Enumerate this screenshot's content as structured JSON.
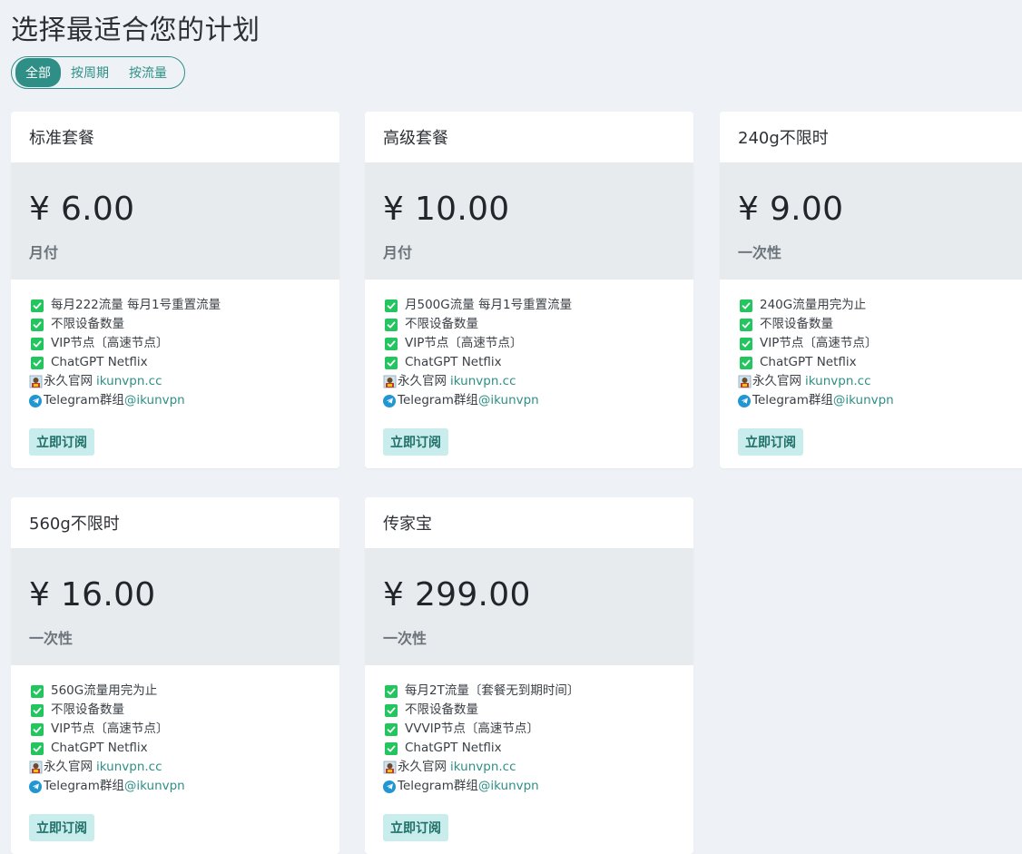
{
  "page": {
    "title": "选择最适合您的计划"
  },
  "filters": [
    {
      "label": "全部",
      "active": true
    },
    {
      "label": "按周期",
      "active": false
    },
    {
      "label": "按流量",
      "active": false
    }
  ],
  "plans": [
    {
      "name": "标准套餐",
      "price": "¥ 6.00",
      "period": "月付",
      "features": [
        "每月222流量 每月1号重置流量",
        "不限设备数量",
        "VIP节点〔高速节点〕",
        "ChatGPT Netflix"
      ],
      "site_text": "永久官网",
      "site_link": "ikunvpn.cc",
      "tg_text": "Telegram群组",
      "tg_link": "@ikunvpn",
      "button": "立即订阅"
    },
    {
      "name": "高级套餐",
      "price": "¥ 10.00",
      "period": "月付",
      "features": [
        "月500G流量 每月1号重置流量",
        "不限设备数量",
        "VIP节点〔高速节点〕",
        "ChatGPT Netflix"
      ],
      "site_text": "永久官网",
      "site_link": "ikunvpn.cc",
      "tg_text": "Telegram群组",
      "tg_link": "@ikunvpn",
      "button": "立即订阅"
    },
    {
      "name": "240g不限时",
      "price": "¥ 9.00",
      "period": "一次性",
      "features": [
        "240G流量用完为止",
        "不限设备数量",
        "VIP节点〔高速节点〕",
        "ChatGPT Netflix"
      ],
      "site_text": "永久官网",
      "site_link": "ikunvpn.cc",
      "tg_text": "Telegram群组",
      "tg_link": "@ikunvpn",
      "button": "立即订阅"
    },
    {
      "name": "560g不限时",
      "price": "¥ 16.00",
      "period": "一次性",
      "features": [
        "560G流量用完为止",
        "不限设备数量",
        "VIP节点〔高速节点〕",
        "ChatGPT Netflix"
      ],
      "site_text": "永久官网",
      "site_link": "ikunvpn.cc",
      "tg_text": "Telegram群组",
      "tg_link": "@ikunvpn",
      "button": "立即订阅"
    },
    {
      "name": "传家宝",
      "price": "¥ 299.00",
      "period": "一次性",
      "features": [
        "每月2T流量〔套餐无到期时间〕",
        "不限设备数量",
        "VVVIP节点〔高速节点〕",
        "ChatGPT Netflix"
      ],
      "site_text": "永久官网",
      "site_link": "ikunvpn.cc",
      "tg_text": "Telegram群组",
      "tg_link": "@ikunvpn",
      "button": "立即订阅"
    }
  ],
  "icons": {
    "check": "check-icon",
    "site": "site-icon",
    "telegram": "telegram-icon"
  },
  "colors": {
    "accent": "#2f8f86",
    "check": "#22c55e",
    "telegram": "#2196d3",
    "price_band": "#e8ebee",
    "button_bg": "#c9ecec"
  }
}
